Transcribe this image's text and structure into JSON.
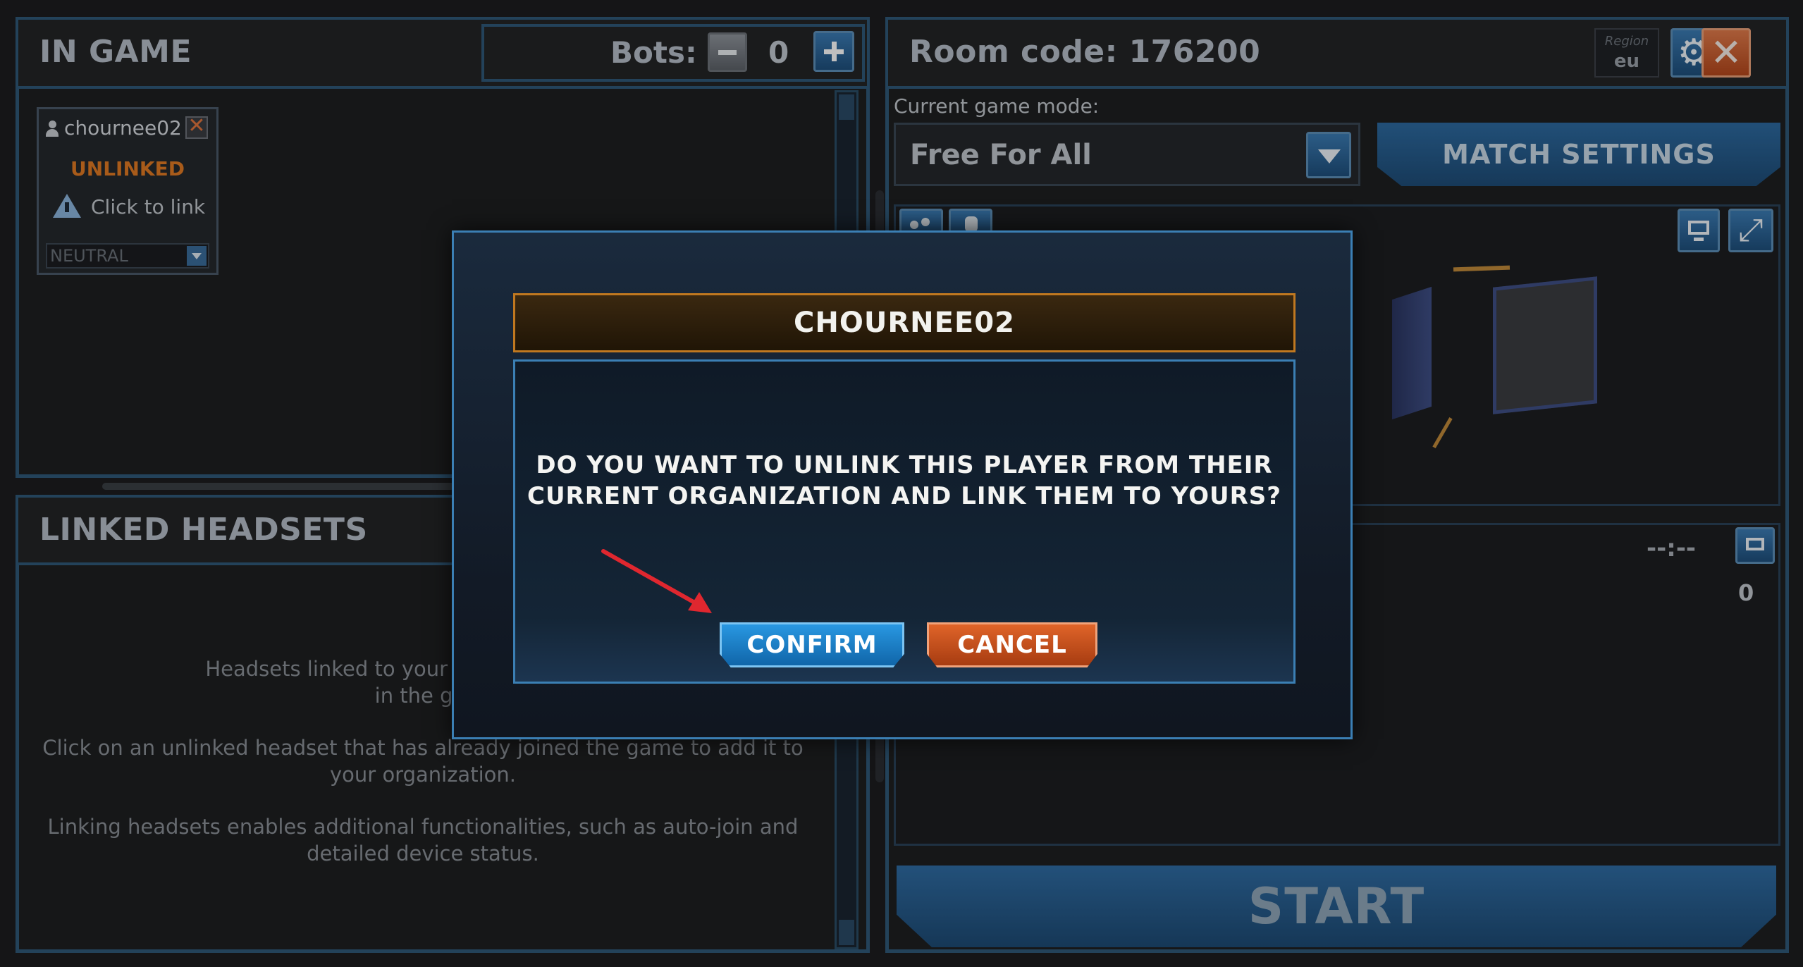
{
  "in_game": {
    "title": "IN GAME",
    "bots_label": "Bots:",
    "bots_count": "0",
    "player": {
      "name": "chournee02",
      "status": "UNLINKED",
      "link_text": "Click to link",
      "team_select": "NEUTRAL"
    }
  },
  "linked_headsets": {
    "title": "LINKED HEADSETS",
    "info_1_line1": "Headsets linked to your organization will a",
    "info_1_line2": "in the gai",
    "info_2_line1": "Click on an unlinked headset that has already joined the game to add it to",
    "info_2_line2": "your organization.",
    "info_3_line1": "Linking headsets enables additional functionalities, such as auto-join and",
    "info_3_line2": "detailed device status."
  },
  "room": {
    "title": "Room code: 176200",
    "region_label": "Region",
    "region_value": "eu",
    "game_mode_label": "Current game mode:",
    "game_mode_value": "Free For All",
    "match_settings_label": "MATCH SETTINGS",
    "timer": "--:--",
    "score": "0",
    "start_label": "START"
  },
  "modal": {
    "title": "CHOURNEE02",
    "message_line1": "DO YOU WANT TO UNLINK THIS PLAYER FROM THEIR",
    "message_line2": "CURRENT ORGANIZATION AND LINK THEM TO YOURS?",
    "confirm_label": "CONFIRM",
    "cancel_label": "CANCEL"
  },
  "colors": {
    "accent_blue": "#2f5878",
    "confirm_blue": "#1a7fc4",
    "cancel_orange": "#c9531a",
    "unlinked_orange": "#e07a23",
    "annotation_arrow": "#e0272f"
  }
}
